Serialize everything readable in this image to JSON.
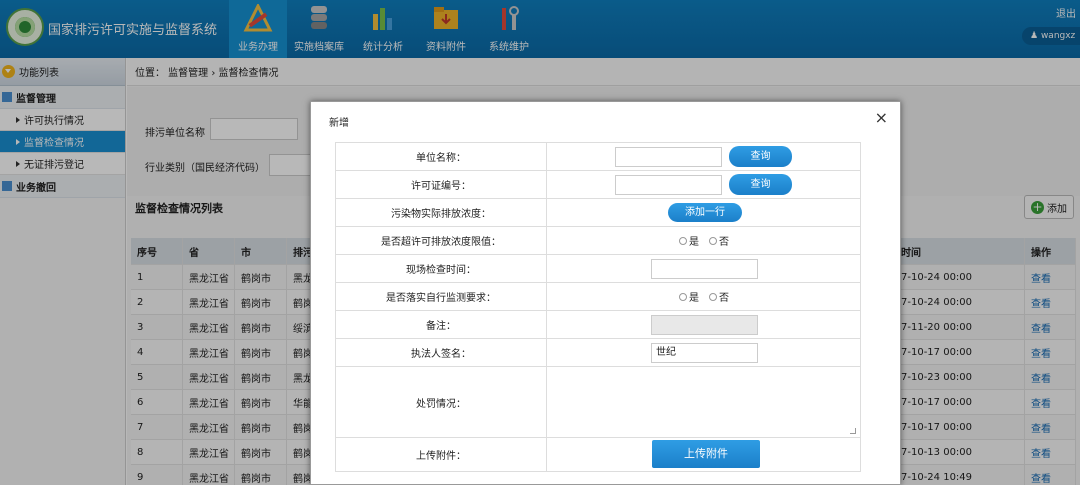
{
  "header": {
    "system_title": "国家排污许可实施与监督系统",
    "nav": [
      {
        "label": "业务办理",
        "icon": "tools-icon"
      },
      {
        "label": "实施档案库",
        "icon": "database-icon"
      },
      {
        "label": "统计分析",
        "icon": "bar-chart-icon"
      },
      {
        "label": "资料附件",
        "icon": "folder-icon"
      },
      {
        "label": "系统维护",
        "icon": "wrench-icon"
      }
    ],
    "logout_label": "退出",
    "username": "wangxz"
  },
  "sidebar": {
    "header": "功能列表",
    "sections": [
      {
        "label": "监督管理",
        "items": [
          "许可执行情况",
          "监督检查情况",
          "无证排污登记"
        ]
      },
      {
        "label": "业务撤回",
        "items": []
      }
    ],
    "active_item": "监督检查情况"
  },
  "main": {
    "breadcrumb": "位置： 监督管理 › 监督检查情况",
    "filter": {
      "unit_name_label": "排污单位名称",
      "industry_label": "行业类别（国民经济代码）"
    },
    "list_title": "监督检查情况列表",
    "add_label": "添加",
    "table": {
      "columns": [
        "序号",
        "省",
        "市",
        "排污",
        "时间",
        "操作"
      ],
      "rows": [
        [
          "1",
          "黑龙江省",
          "鹤岗市",
          "黑龙",
          "7-10-24 00:00",
          "查看"
        ],
        [
          "2",
          "黑龙江省",
          "鹤岗市",
          "鹤岗",
          "7-10-24 00:00",
          "查看"
        ],
        [
          "3",
          "黑龙江省",
          "鹤岗市",
          "绥滨",
          "7-11-20 00:00",
          "查看"
        ],
        [
          "4",
          "黑龙江省",
          "鹤岗市",
          "鹤岗",
          "7-10-17 00:00",
          "查看"
        ],
        [
          "5",
          "黑龙江省",
          "鹤岗市",
          "黑龙",
          "7-10-23 00:00",
          "查看"
        ],
        [
          "6",
          "黑龙江省",
          "鹤岗市",
          "华能",
          "7-10-17 00:00",
          "查看"
        ],
        [
          "7",
          "黑龙江省",
          "鹤岗市",
          "鹤岗",
          "7-10-17 00:00",
          "查看"
        ],
        [
          "8",
          "黑龙江省",
          "鹤岗市",
          "鹤岗",
          "7-10-13 00:00",
          "查看"
        ],
        [
          "9",
          "黑龙江省",
          "鹤岗市",
          "鹤岗",
          "7-10-24 10:49",
          "查看"
        ]
      ]
    }
  },
  "modal": {
    "title": "新增",
    "close": "×",
    "fields": {
      "unit_name": {
        "label": "单位名称：",
        "button": "查询"
      },
      "permit_no": {
        "label": "许可证编号：",
        "button": "查询"
      },
      "pollutant": {
        "label": "污染物实际排放浓度：",
        "button": "添加一行"
      },
      "exceed": {
        "label": "是否超许可排放浓度限值：",
        "yes": "是",
        "no": "否"
      },
      "inspect_time": {
        "label": "现场检查时间："
      },
      "self_monitor": {
        "label": "是否落实自行监测要求：",
        "yes": "是",
        "no": "否"
      },
      "remark": {
        "label": "备注："
      },
      "signer": {
        "label": "执法人签名：",
        "value": "世纪"
      },
      "penalty": {
        "label": "处罚情况："
      },
      "upload": {
        "label": "上传附件：",
        "button": "上传附件"
      }
    }
  }
}
